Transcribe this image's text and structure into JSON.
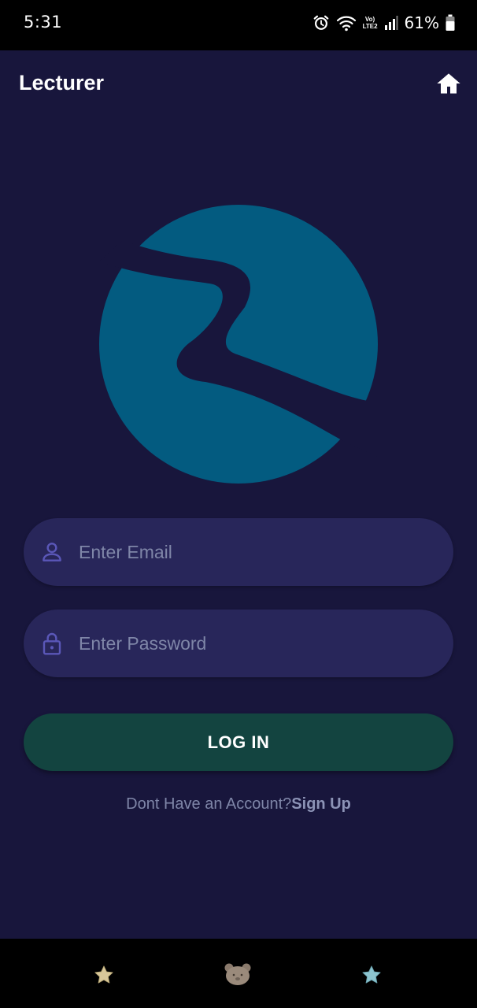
{
  "status_bar": {
    "time": "5:31",
    "network_label_top": "Vo)",
    "network_label_bottom": "LTE2",
    "battery_percent": "61%"
  },
  "header": {
    "title": "Lecturer",
    "home_icon": "home-icon"
  },
  "form": {
    "email": {
      "placeholder": "Enter Email",
      "value": "",
      "icon": "person-icon"
    },
    "password": {
      "placeholder": "Enter Password",
      "value": "",
      "icon": "lock-icon"
    },
    "login_label": "LOG IN",
    "signup_prompt": "Dont Have an Account?",
    "signup_link": "Sign Up"
  },
  "nav_bar": {
    "left_icon": "star-icon",
    "center_icon": "bear-icon",
    "right_icon": "star-icon"
  },
  "colors": {
    "background": "#18163c",
    "logo": "#035b80",
    "field_bg": "#28265a",
    "field_icon": "#5a57b8",
    "button_bg": "#134440",
    "muted_text": "#7f86a8"
  }
}
